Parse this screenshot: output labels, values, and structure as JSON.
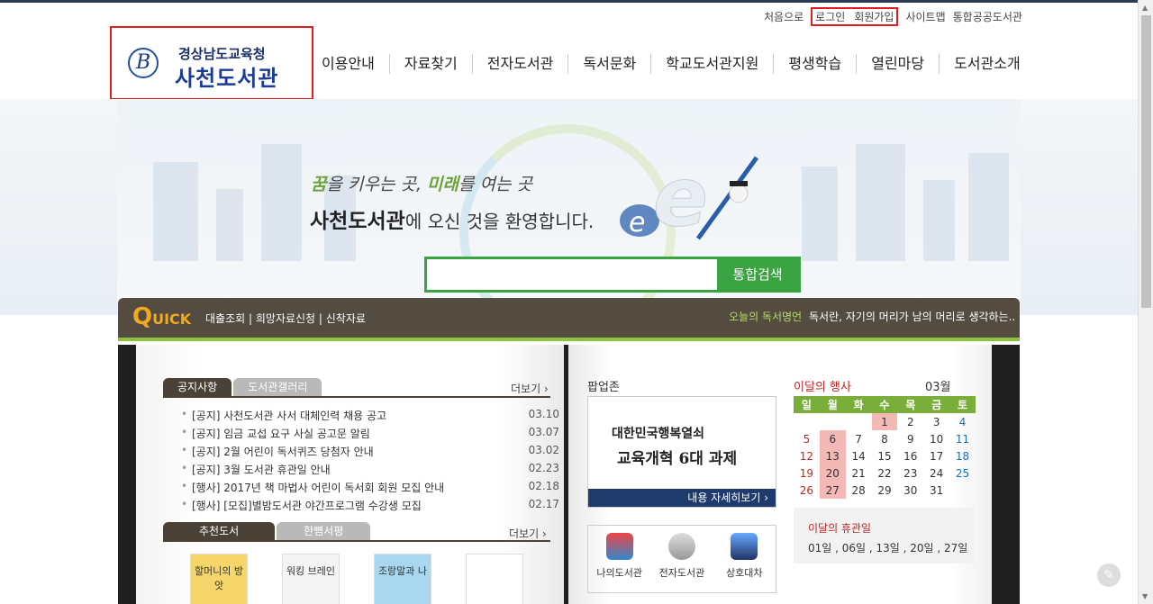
{
  "util": {
    "home": "처음으로",
    "login": "로그인",
    "join": "회원가입",
    "sitemap": "사이트맵",
    "integrated": "통합공공도서관"
  },
  "logo": {
    "line1": "경상남도교육청",
    "line2": "사천도서관"
  },
  "nav": [
    "이용안내",
    "자료찾기",
    "전자도서관",
    "독서문화",
    "학교도서관지원",
    "평생학습",
    "열린마당",
    "도서관소개"
  ],
  "hero": {
    "slogan_a": "꿈",
    "slogan_b": "을 키우는 곳, ",
    "slogan_c": "미래",
    "slogan_d": "를 여는 곳",
    "welcome_bold": "사천도서관",
    "welcome_rest": "에 오신 것을 환영합니다."
  },
  "search": {
    "placeholder": "",
    "button": "통합검색"
  },
  "quick": {
    "logo_big": "Q",
    "logo_rest": "UICK",
    "links": "대출조회 | 희망자료신청 | 신착자료",
    "quote_label": "오늘의 독서명언",
    "quote": "독서란, 자기의 머리가 남의 머리로 생각하는.."
  },
  "notice": {
    "tabs": [
      "공지사항",
      "도서관갤러리"
    ],
    "more": "더보기 ›",
    "items": [
      {
        "title": "[공지] 사천도서관 사서 대체인력 채용 공고",
        "date": "03.10"
      },
      {
        "title": "[공지] 임금 교섭 요구 사실 공고문 알림",
        "date": "03.07"
      },
      {
        "title": "[공지] 2월 어린이 독서퀴즈 당첨자 안내",
        "date": "03.02"
      },
      {
        "title": "[공지] 3월 도서관 휴관일 안내",
        "date": "02.23"
      },
      {
        "title": "[행사] 2017년 책 마법사 어린이 독서회 회원 모집 안내",
        "date": "02.18"
      },
      {
        "title": "[행사] [모집]별밤도서관 야간프로그램 수강생 모집",
        "date": "02.17"
      }
    ]
  },
  "books": {
    "tabs": [
      "추천도서",
      "한뼘서평"
    ],
    "more": "더보기 ›",
    "items": [
      "할머니의 방앗",
      "워킹 브레인",
      "조랑말과 나",
      ""
    ]
  },
  "popup": {
    "title": "팝업존",
    "line1": "대한민국행복열쇠",
    "line2": "교육개혁 6대 과제",
    "link": "내용 자세히보기 ›"
  },
  "services": [
    "나의도서관",
    "전자도서관",
    "상호대차"
  ],
  "calendar": {
    "title": "이달의 행사",
    "month": "03월",
    "weekdays": [
      "일",
      "월",
      "화",
      "수",
      "목",
      "금",
      "토"
    ],
    "weeks": [
      [
        "",
        "",
        "",
        "1",
        "2",
        "3",
        "4"
      ],
      [
        "5",
        "6",
        "7",
        "8",
        "9",
        "10",
        "11"
      ],
      [
        "12",
        "13",
        "14",
        "15",
        "16",
        "17",
        "18"
      ],
      [
        "19",
        "20",
        "21",
        "22",
        "23",
        "24",
        "25"
      ],
      [
        "26",
        "27",
        "28",
        "29",
        "30",
        "31",
        ""
      ]
    ],
    "holidays": [
      "1",
      "6",
      "13",
      "20",
      "27"
    ]
  },
  "closed": {
    "title": "이달의 휴관일",
    "days": "01일 , 06일 , 13일 , 20일 , 27일"
  }
}
